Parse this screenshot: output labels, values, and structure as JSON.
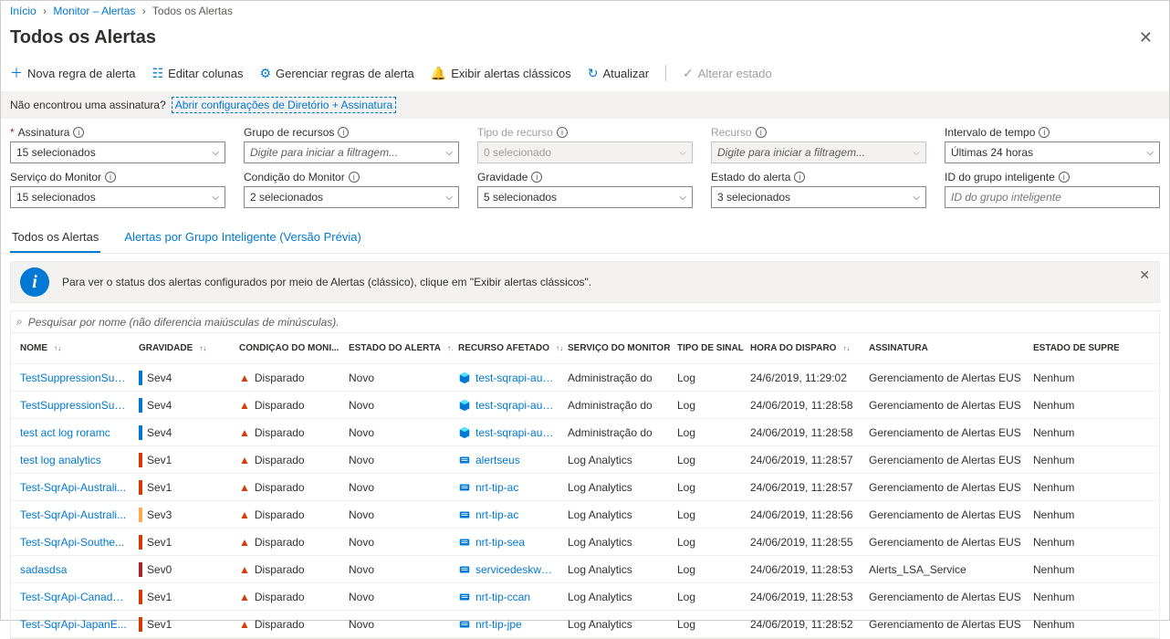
{
  "breadcrumb": {
    "home": "Início",
    "monitor": "Monitor – Alertas",
    "current": "Todos os Alertas"
  },
  "page_title": "Todos os Alertas",
  "toolbar": {
    "new_rule": "Nova regra de alerta",
    "edit_cols": "Editar colunas",
    "manage_rules": "Gerenciar regras de alerta",
    "classic": "Exibir alertas clássicos",
    "refresh": "Atualizar",
    "change_state": "Alterar estado"
  },
  "sub_bar": {
    "text": "Não encontrou uma assinatura?",
    "link": "Abrir configurações de Diretório + Assinatura"
  },
  "filters": {
    "subscription": {
      "label": "Assinatura",
      "value": "15 selecionados"
    },
    "resource_group": {
      "label": "Grupo de recursos",
      "placeholder": "Digite para iniciar a filtragem..."
    },
    "resource_type": {
      "label": "Tipo de recurso",
      "value": "0 selecionado"
    },
    "resource": {
      "label": "Recurso",
      "placeholder": "Digite para iniciar a filtragem..."
    },
    "time_range": {
      "label": "Intervalo de tempo",
      "value": "Últimas 24 horas"
    },
    "monitor_service": {
      "label": "Serviço do Monitor",
      "value": "15 selecionados"
    },
    "monitor_condition": {
      "label": "Condição do Monitor",
      "value": "2 selecionados"
    },
    "severity": {
      "label": "Gravidade",
      "value": "5 selecionados"
    },
    "alert_state": {
      "label": "Estado do alerta",
      "value": "3 selecionados"
    },
    "smart_group": {
      "label": "ID do grupo inteligente",
      "placeholder": "ID do grupo inteligente"
    }
  },
  "tabs": {
    "all": "Todos os Alertas",
    "smart": "Alertas por Grupo Inteligente (Versão Prévia)"
  },
  "banner": {
    "text": "Para ver o status dos alertas configurados por meio de Alertas (clássico), clique em \"Exibir alertas clássicos\"."
  },
  "search_placeholder": "Pesquisar por nome (não diferencia maiúsculas de minúsculas).",
  "columns": {
    "name": "NOME",
    "sev": "GRAVIDADE",
    "cond": "CONDIÇÃO DO MONI...",
    "state": "ESTADO DO ALERTA",
    "res": "RECURSO AFETADO",
    "mon": "SERVIÇO DO MONITOR",
    "sig": "TIPO DE SINAL",
    "time": "HORA DO DISPARO",
    "sub": "ASSINATURA",
    "sup": "ESTADO DE SUPRESSÃO"
  },
  "rows": [
    {
      "name": "TestSuppressionSub...",
      "sev": "Sev4",
      "sevc": "sev4",
      "cond": "Disparado",
      "state": "Novo",
      "res": "test-sqrapi-aust...",
      "ric": "cube",
      "mon": "Administração do",
      "sig": "Log",
      "time": "24/6/2019, 11:29:02",
      "sub": "Gerenciamento de Alertas EUS",
      "sup": "Nenhum"
    },
    {
      "name": "TestSuppressionSub...",
      "sev": "Sev4",
      "sevc": "sev4",
      "cond": "Disparado",
      "state": "Novo",
      "res": "test-sqrapi-aust...",
      "ric": "cube",
      "mon": "Administração do",
      "sig": "Log",
      "time": "24/06/2019, 11:28:58",
      "sub": "Gerenciamento de Alertas EUS",
      "sup": "Nenhum"
    },
    {
      "name": "test act log roramc",
      "sev": "Sev4",
      "sevc": "sev4",
      "cond": "Disparado",
      "state": "Novo",
      "res": "test-sqrapi-aust...",
      "ric": "cube",
      "mon": "Administração do",
      "sig": "Log",
      "time": "24/06/2019, 11:28:58",
      "sub": "Gerenciamento de Alertas EUS",
      "sup": "Nenhum"
    },
    {
      "name": "test log analytics",
      "sev": "Sev1",
      "sevc": "sev1",
      "cond": "Disparado",
      "state": "Novo",
      "res": "alertseus",
      "ric": "db",
      "mon": "Log Analytics",
      "sig": "Log",
      "time": "24/06/2019, 11:28:57",
      "sub": "Gerenciamento de Alertas EUS",
      "sup": "Nenhum"
    },
    {
      "name": "Test-SqrApi-Australi...",
      "sev": "Sev1",
      "sevc": "sev1",
      "cond": "Disparado",
      "state": "Novo",
      "res": "nrt-tip-ac",
      "ric": "db",
      "mon": "Log Analytics",
      "sig": "Log",
      "time": "24/06/2019, 11:28:57",
      "sub": "Gerenciamento de Alertas EUS",
      "sup": "Nenhum"
    },
    {
      "name": "Test-SqrApi-Australi...",
      "sev": "Sev3",
      "sevc": "sev3",
      "cond": "Disparado",
      "state": "Novo",
      "res": "nrt-tip-ac",
      "ric": "db",
      "mon": "Log Analytics",
      "sig": "Log",
      "time": "24/06/2019, 11:28:56",
      "sub": "Gerenciamento de Alertas EUS",
      "sup": "Nenhum"
    },
    {
      "name": "Test-SqrApi-Southe...",
      "sev": "Sev1",
      "sevc": "sev1",
      "cond": "Disparado",
      "state": "Novo",
      "res": "nrt-tip-sea",
      "ric": "db",
      "mon": "Log Analytics",
      "sig": "Log",
      "time": "24/06/2019, 11:28:55",
      "sub": "Gerenciamento de Alertas EUS",
      "sup": "Nenhum"
    },
    {
      "name": "sadasdsa",
      "sev": "Sev0",
      "sevc": "sev0",
      "cond": "Disparado",
      "state": "Novo",
      "res": "servicedeskwcus",
      "ric": "db",
      "mon": "Log Analytics",
      "sig": "Log",
      "time": "24/06/2019, 11:28:53",
      "sub": "Alerts_LSA_Service",
      "sup": "Nenhum"
    },
    {
      "name": "Test-SqrApi-Canada...",
      "sev": "Sev1",
      "sevc": "sev1",
      "cond": "Disparado",
      "state": "Novo",
      "res": "nrt-tip-ccan",
      "ric": "db",
      "mon": "Log Analytics",
      "sig": "Log",
      "time": "24/06/2019, 11:28:53",
      "sub": "Gerenciamento de Alertas EUS",
      "sup": "Nenhum"
    },
    {
      "name": "Test-SqrApi-JapanE...",
      "sev": "Sev1",
      "sevc": "sev1",
      "cond": "Disparado",
      "state": "Novo",
      "res": "nrt-tip-jpe",
      "ric": "db",
      "mon": "Log Analytics",
      "sig": "Log",
      "time": "24/06/2019, 11:28:52",
      "sub": "Gerenciamento de Alertas EUS",
      "sup": "Nenhum"
    }
  ]
}
